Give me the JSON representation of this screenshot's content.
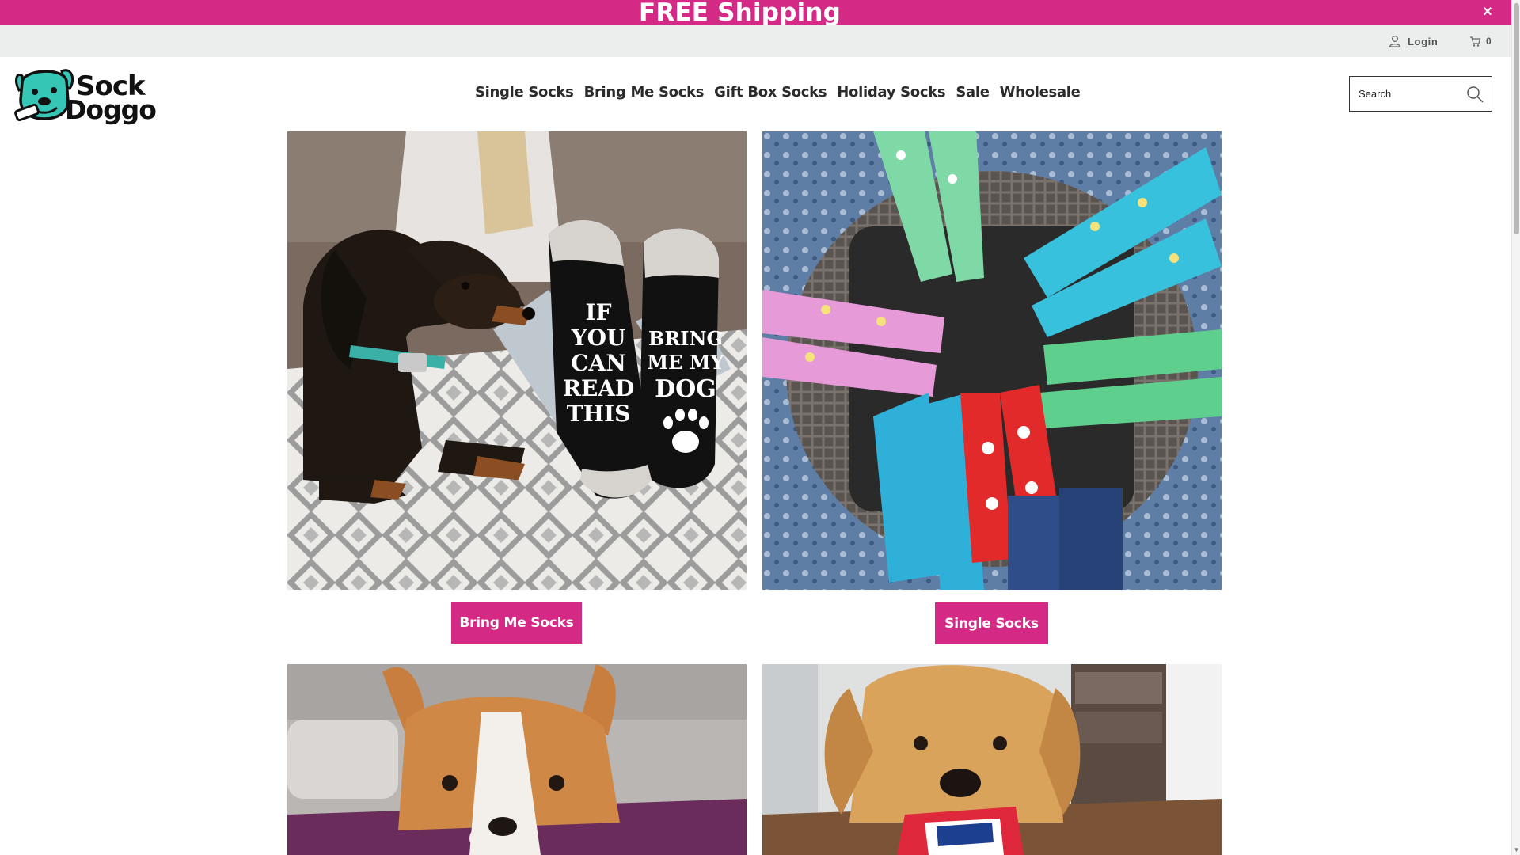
{
  "announcement": {
    "text": "FREE Shipping",
    "close_label": "×"
  },
  "utility": {
    "login_label": "Login",
    "cart_count": "0"
  },
  "brand": {
    "name_line1": "Sock",
    "name_line2": "Doggo"
  },
  "nav": {
    "items": [
      "Single Socks",
      "Bring Me Socks",
      "Gift Box Socks",
      "Holiday Socks",
      "Sale",
      "Wholesale"
    ]
  },
  "search": {
    "placeholder": "Search"
  },
  "tiles": [
    {
      "button_label": "Bring Me Socks",
      "sock_left": [
        "IF",
        "YOU",
        "CAN",
        "READ",
        "THIS"
      ],
      "sock_right": [
        "BRING",
        "ME MY",
        "DOG"
      ]
    },
    {
      "button_label": "Single Socks"
    }
  ],
  "colors": {
    "accent": "#d42a86",
    "utility_bg": "#eceeee",
    "logo_teal": "#36c6b6"
  }
}
